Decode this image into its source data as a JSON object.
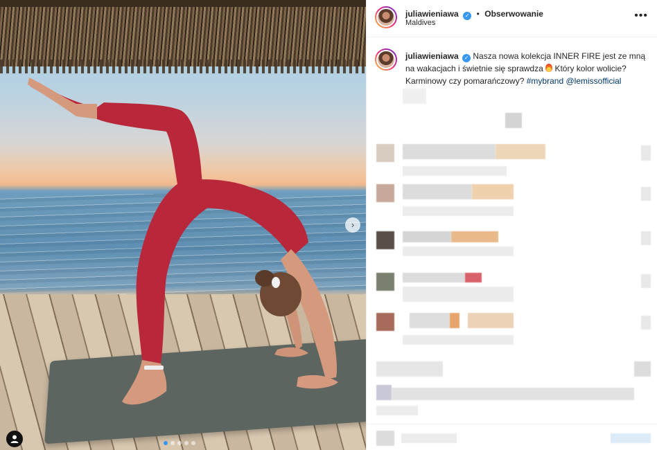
{
  "post": {
    "username": "juliawieniawa",
    "separator": "•",
    "follow_label": "Obserwowanie",
    "location": "Maldives",
    "more_label": "•••",
    "verified_mark": "✓",
    "caption_text": "Nasza nowa kolekcja INNER FIRE jest ze mną na wakacjach i świetnie się sprawdza",
    "caption_after_emoji": "Który kolor wolicie? Karminowy czy pomarańczowy?",
    "hashtag": "#mybrand",
    "mention": "@lemissofficial"
  },
  "media": {
    "carousel_dots": 5,
    "active_dot": 0,
    "next_arrow": "›"
  },
  "icons": {
    "tag_user": "person-icon",
    "verified": "verified-badge-icon",
    "emoji": "fire-emoji-icon"
  },
  "colors": {
    "accent": "#3897f0",
    "link": "#00376b",
    "text": "#262626",
    "outfit": "#b8283a"
  }
}
